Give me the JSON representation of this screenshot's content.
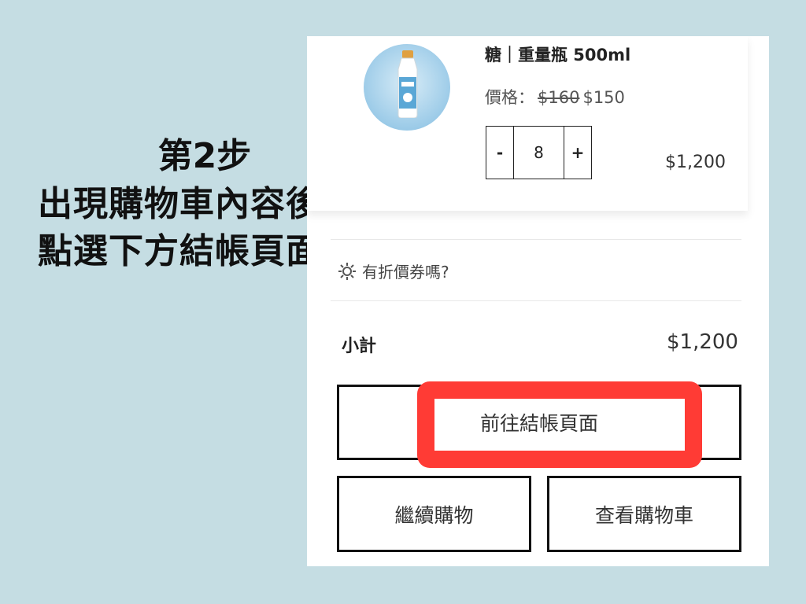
{
  "instructions": {
    "step": "第2步",
    "line1": "出現購物車內容後",
    "line2": "點選下方結帳頁面"
  },
  "cart": {
    "item": {
      "name": "糖｜重量瓶 500ml",
      "price_label": "價格：",
      "old_price": "$160",
      "new_price": "$150",
      "qty_minus": "-",
      "quantity": "8",
      "qty_plus": "+",
      "line_total": "$1,200"
    },
    "coupon_text": "有折價券嗎?",
    "subtotal_label": "小計",
    "subtotal_value": "$1,200",
    "checkout_button": "前往結帳頁面",
    "continue_button": "繼續購物",
    "view_cart_button": "查看購物車"
  },
  "colors": {
    "background": "#c5dde3",
    "highlight": "#ff3b35"
  },
  "icons": [
    "coupon-gear-icon",
    "product-bottle-image"
  ]
}
